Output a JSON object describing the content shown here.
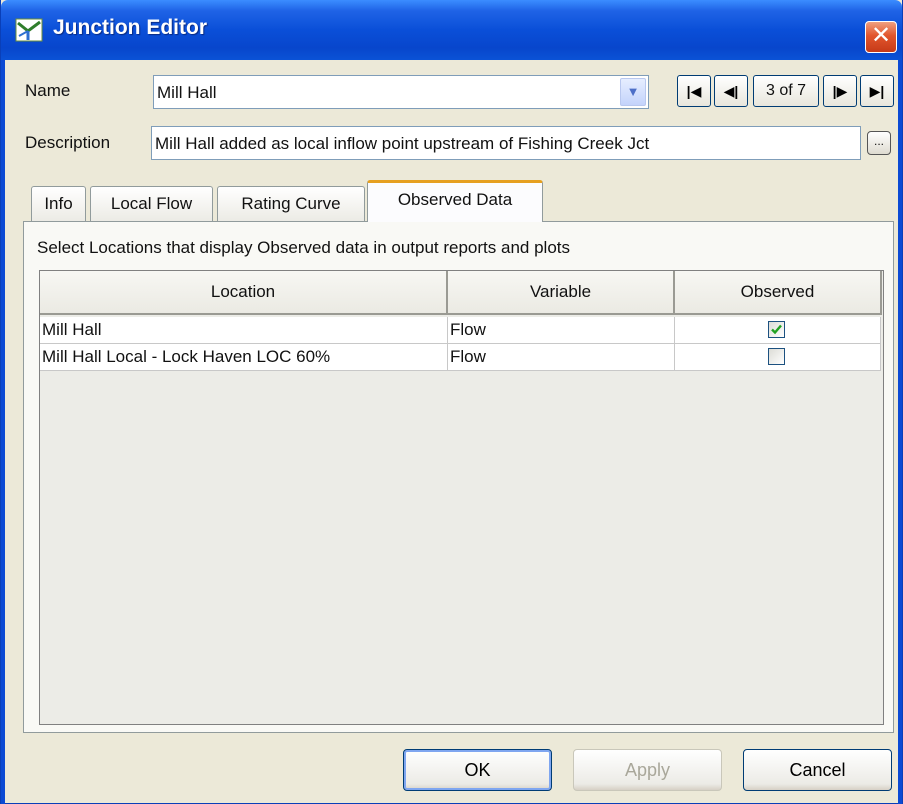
{
  "window": {
    "title": "Junction Editor",
    "close_label": "✕",
    "accent_color": "#0a4fd8"
  },
  "form": {
    "name_label": "Name",
    "name_value": "Mill Hall",
    "nav": {
      "first": "|◀",
      "prev": "◀|",
      "position": "3 of 7",
      "next": "|▶",
      "last": "▶|"
    },
    "description_label": "Description",
    "description_value": "Mill Hall added as local inflow point upstream of Fishing Creek Jct",
    "ellipsis_label": "..."
  },
  "tabs": [
    {
      "label": "Info",
      "active": false
    },
    {
      "label": "Local Flow",
      "active": false
    },
    {
      "label": "Rating Curve",
      "active": false
    },
    {
      "label": "Observed Data",
      "active": true
    }
  ],
  "observed_panel": {
    "instruction": "Select Locations that display Observed data in output reports and plots",
    "columns": [
      "Location",
      "Variable",
      "Observed"
    ],
    "rows": [
      {
        "location": "Mill Hall",
        "variable": "Flow",
        "observed": true
      },
      {
        "location": "Mill Hall Local - Lock Haven LOC 60%",
        "variable": "Flow",
        "observed": false
      }
    ]
  },
  "buttons": {
    "ok": "OK",
    "apply": "Apply",
    "cancel": "Cancel"
  }
}
